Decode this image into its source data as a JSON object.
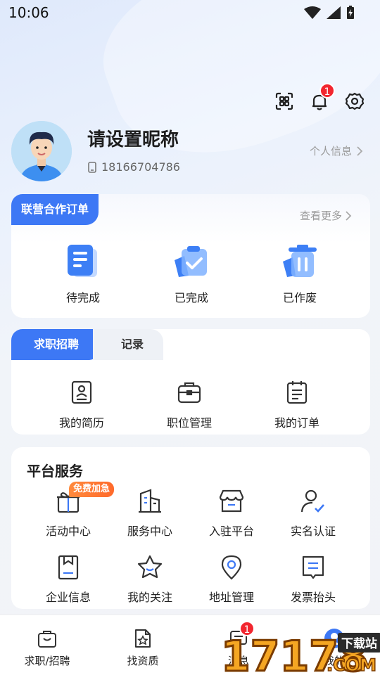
{
  "status_bar": {
    "time": "10:06"
  },
  "header": {
    "notification_count": "1"
  },
  "profile": {
    "nickname": "请设置昵称",
    "phone": "18166704786",
    "personal_info_link": "个人信息"
  },
  "joint_orders": {
    "tag": "联营合作订单",
    "more": "查看更多",
    "items": [
      {
        "label": "待完成",
        "icon": "pending-document-icon"
      },
      {
        "label": "已完成",
        "icon": "completed-clipboard-icon"
      },
      {
        "label": "已作废",
        "icon": "voided-trash-icon"
      }
    ]
  },
  "job_section": {
    "tabs": [
      {
        "label": "求职招聘",
        "active": true
      },
      {
        "label": "记录",
        "active": false
      }
    ],
    "items": [
      {
        "label": "我的简历",
        "icon": "resume-icon"
      },
      {
        "label": "职位管理",
        "icon": "briefcase-icon"
      },
      {
        "label": "我的订单",
        "icon": "order-list-icon"
      }
    ]
  },
  "platform_services": {
    "title": "平台服务",
    "promo_tag": "免费加急",
    "items": [
      {
        "label": "活动中心",
        "icon": "gift-icon"
      },
      {
        "label": "服务中心",
        "icon": "building-icon"
      },
      {
        "label": "入驻平台",
        "icon": "store-icon"
      },
      {
        "label": "实名认证",
        "icon": "user-check-icon"
      },
      {
        "label": "企业信息",
        "icon": "company-info-icon"
      },
      {
        "label": "我的关注",
        "icon": "star-icon"
      },
      {
        "label": "地址管理",
        "icon": "location-pin-icon"
      },
      {
        "label": "发票抬头",
        "icon": "invoice-icon"
      }
    ]
  },
  "bottom_nav": {
    "items": [
      {
        "label": "求职/招聘",
        "icon": "bag-icon"
      },
      {
        "label": "找资质",
        "icon": "certificate-icon"
      },
      {
        "label": "消息",
        "icon": "message-icon",
        "badge": "1"
      },
      {
        "label": "我的",
        "icon": "profile-icon"
      }
    ]
  },
  "watermark": {
    "site": "17178",
    "domain": ".COM",
    "tag": "下载站"
  },
  "colors": {
    "accent": "#3d78f5",
    "promo": "#ff7a35",
    "badge": "#f2262f"
  }
}
